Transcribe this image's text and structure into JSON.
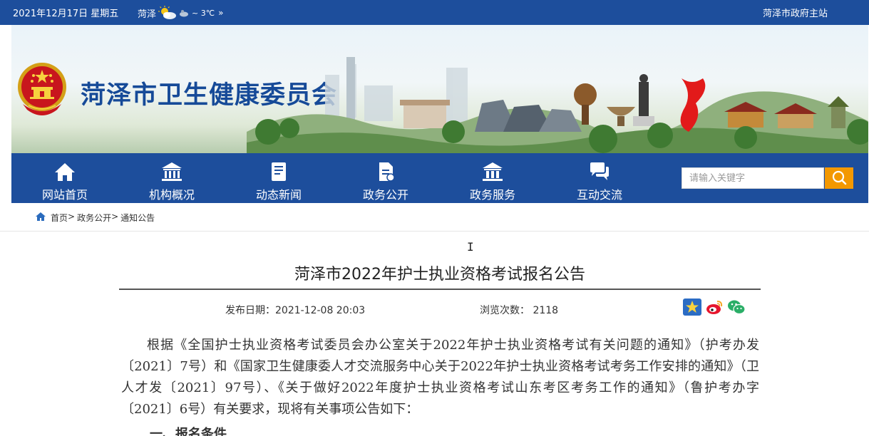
{
  "topbar": {
    "date": "2021年12月17日 星期五",
    "city": "菏泽",
    "temperature": "~ 3℃",
    "more": "»",
    "portal_link": "菏泽市政府主站"
  },
  "banner": {
    "site_title": "菏泽市卫生健康委员会",
    "emblem_icon": "national-emblem-icon"
  },
  "nav": {
    "items": [
      {
        "label": "网站首页",
        "icon": "home-icon"
      },
      {
        "label": "机构概况",
        "icon": "institution-icon"
      },
      {
        "label": "动态新闻",
        "icon": "news-icon"
      },
      {
        "label": "政务公开",
        "icon": "document-icon"
      },
      {
        "label": "政务服务",
        "icon": "service-icon"
      },
      {
        "label": "互动交流",
        "icon": "chat-icon"
      }
    ],
    "search_placeholder": "请输入关键字",
    "search_icon": "search-icon",
    "accent": "#f39800",
    "bar_color": "#1d4e9c"
  },
  "breadcrumb": {
    "items": [
      "首页",
      "政务公开",
      "通知公告"
    ],
    "separator": ">"
  },
  "article": {
    "title": "菏泽市2022年护士执业资格考试报名公告",
    "publish_label": "发布日期：",
    "publish_date": "2021-12-08 20:03",
    "views_label": "浏览次数：",
    "views": "2118",
    "share_icons": [
      "star-share-icon",
      "weibo-icon",
      "wechat-icon"
    ],
    "body": "根据《全国护士执业资格考试委员会办公室关于2022年护士执业资格考试有关问题的通知》（护考办发〔2021〕7号）和《国家卫生健康委人才交流服务中心关于2022年护士执业资格考试考务工作安排的通知》（卫人才发〔2021〕97号）、《关于做好2022年度护士执业资格考试山东考区考务工作的通知》（鲁护考办字〔2021〕6号）有关要求，现将有关事项公告如下：",
    "section_heading": "一、报名条件"
  }
}
